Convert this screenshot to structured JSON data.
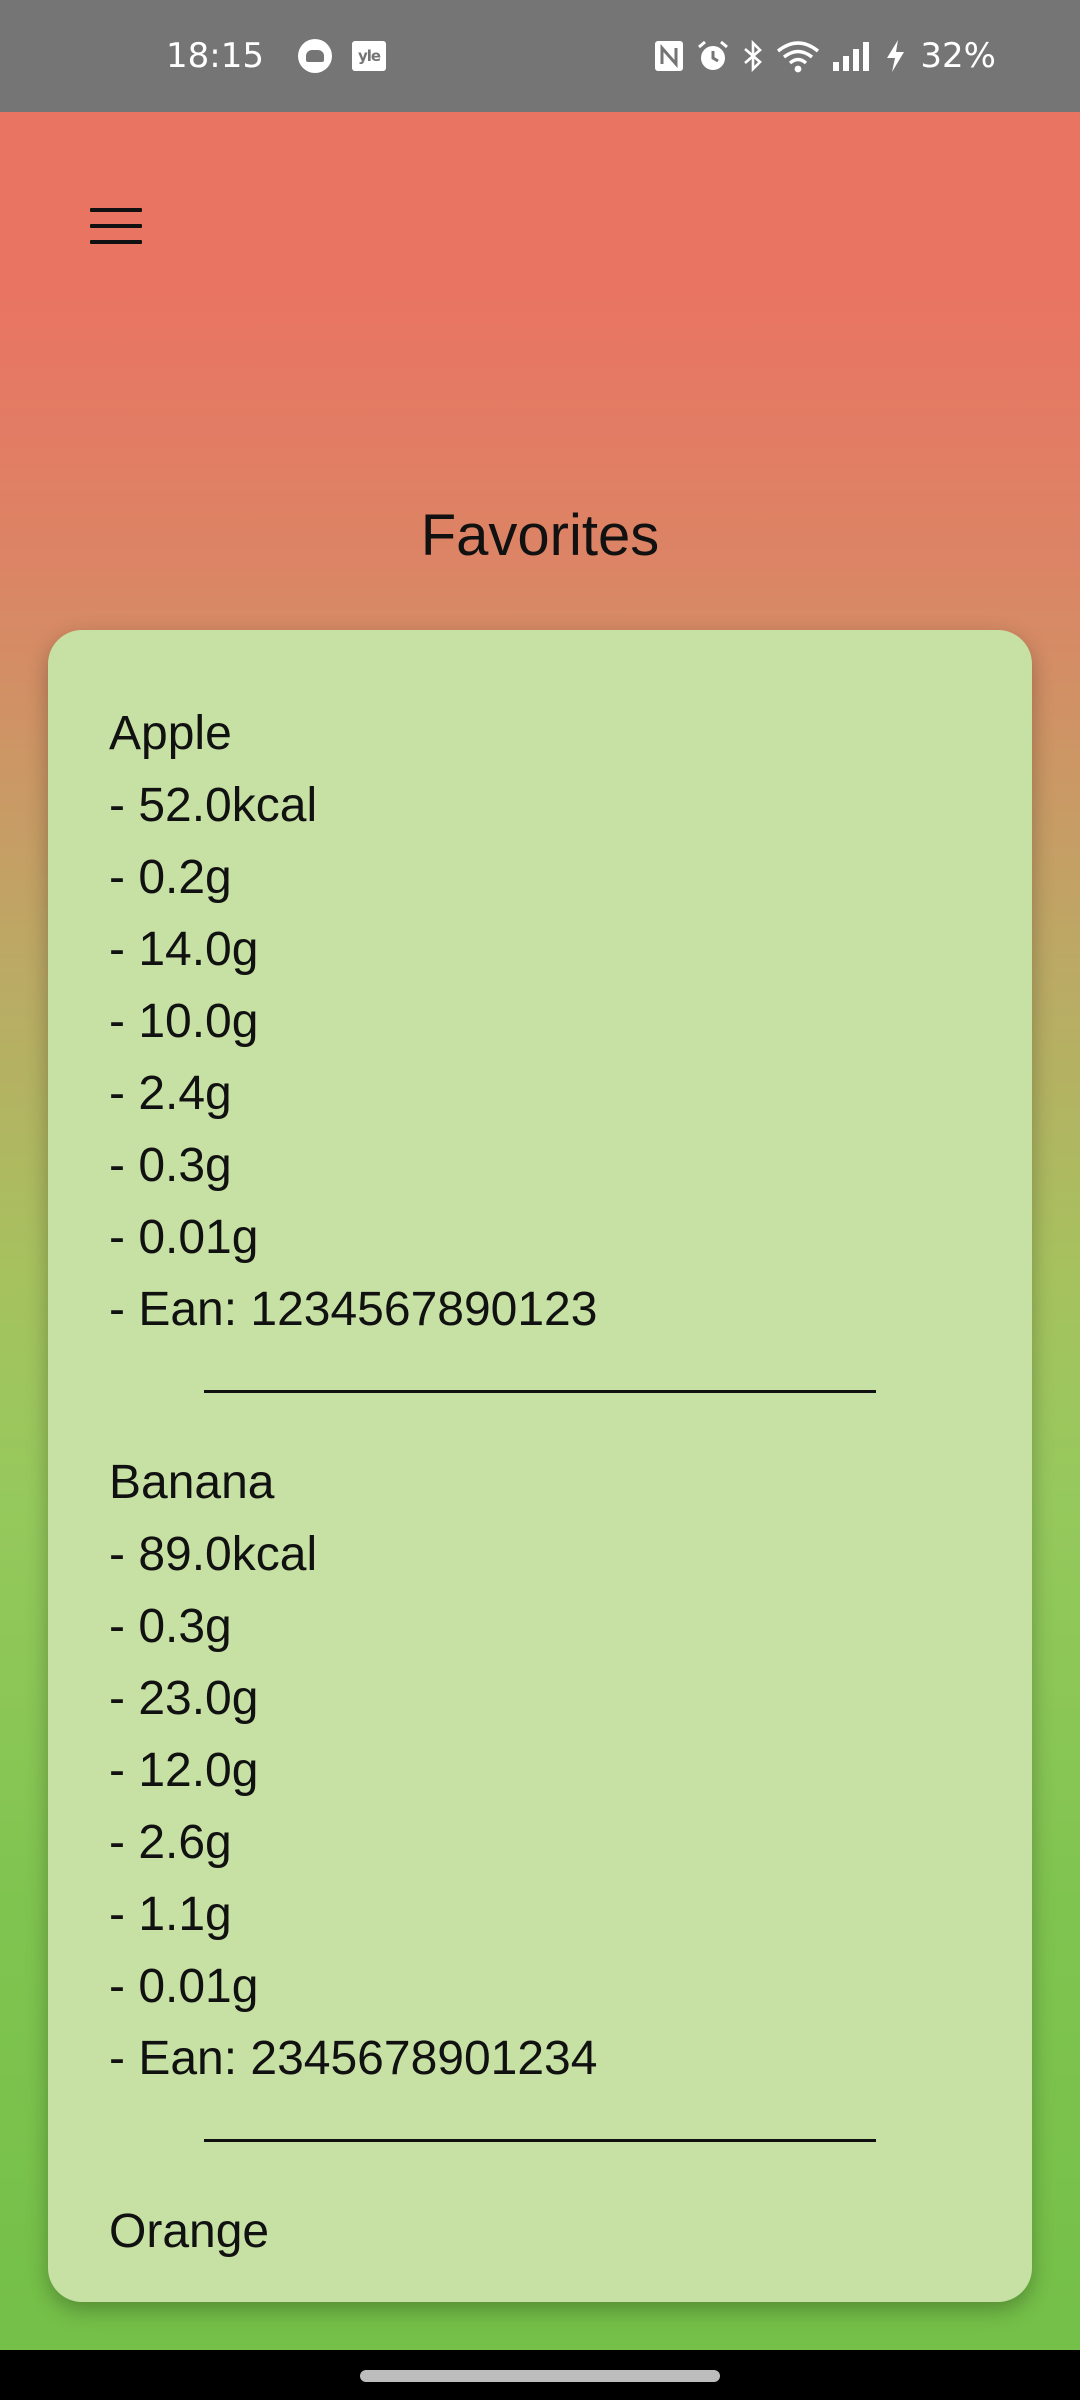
{
  "status_bar": {
    "time": "18:15",
    "battery": "32%",
    "notification_icons": [
      "fox-app-icon",
      "yle-app-icon"
    ],
    "notification_yle_text": "yle",
    "system_icons": [
      "nfc-icon",
      "alarm-icon",
      "bluetooth-icon",
      "wifi-icon",
      "signal-icon",
      "charging-icon"
    ]
  },
  "app": {
    "title": "Favorites",
    "menu_icon": "hamburger-menu-icon",
    "colors": {
      "header_top": "#e97462",
      "bottom": "#74c048",
      "card": "#c6e1a3"
    }
  },
  "favorites": [
    {
      "name": "Apple",
      "details": [
        "- 52.0kcal",
        "- 0.2g",
        "- 14.0g",
        "- 10.0g",
        "- 2.4g",
        "- 0.3g",
        "- 0.01g",
        "- Ean: 1234567890123"
      ]
    },
    {
      "name": "Banana",
      "details": [
        "- 89.0kcal",
        "- 0.3g",
        "- 23.0g",
        "- 12.0g",
        "- 2.6g",
        "- 1.1g",
        "- 0.01g",
        "- Ean: 2345678901234"
      ]
    },
    {
      "name": "Orange",
      "details": []
    }
  ]
}
